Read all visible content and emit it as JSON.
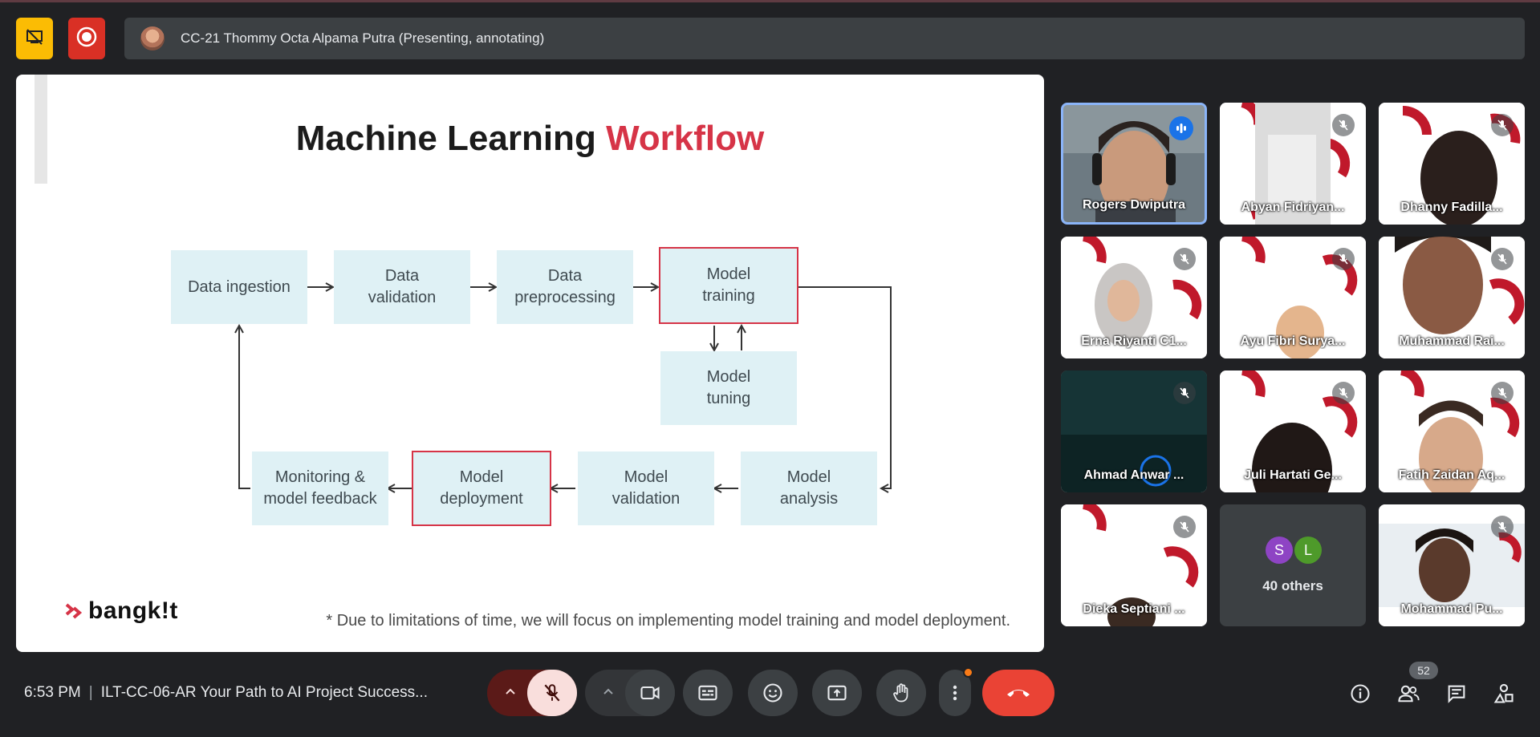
{
  "presenter_bar": {
    "text": "CC-21 Thommy Octa Alpama Putra (Presenting, annotating)"
  },
  "slide": {
    "title_main": "Machine Learning",
    "title_highlight": "Workflow",
    "highlight_color": "#d63447",
    "boxes": {
      "data_ingestion": "Data ingestion",
      "data_validation": "Data\nvalidation",
      "data_preprocessing": "Data\npreprocessing",
      "model_training": "Model\ntraining",
      "model_tuning": "Model\ntuning",
      "model_analysis": "Model\nanalysis",
      "model_validation": "Model\nvalidation",
      "model_deployment": "Model\ndeployment",
      "monitoring": "Monitoring &\nmodel feedback"
    },
    "logo_text": "bangk!t",
    "footnote": "* Due to limitations of time, we will focus on implementing model training and model deployment."
  },
  "participants": [
    {
      "name": "Rogers Dwiputra",
      "state": "speaking"
    },
    {
      "name": "Abyan Fidriyan...",
      "state": "muted"
    },
    {
      "name": "Dhanny Fadilla...",
      "state": "muted"
    },
    {
      "name": "Erna Riyanti C1...",
      "state": "muted"
    },
    {
      "name": "Ayu Fibri Surya...",
      "state": "muted"
    },
    {
      "name": "Muhammad Rai...",
      "state": "muted"
    },
    {
      "name": "Ahmad Anwar ...",
      "state": "muted"
    },
    {
      "name": "Juli Hartati Ge...",
      "state": "muted"
    },
    {
      "name": "Fatih Zaidan Aq...",
      "state": "muted"
    },
    {
      "name": "Dieka Septiani ...",
      "state": "muted"
    },
    {
      "name": "Mohammad Pu...",
      "state": "muted"
    }
  ],
  "others_tile": {
    "avatars": [
      {
        "letter": "S",
        "color": "#8e44c4"
      },
      {
        "letter": "L",
        "color": "#4e9a2a"
      }
    ],
    "label": "40 others"
  },
  "bottom_bar": {
    "time": "6:53 PM",
    "separator": "|",
    "meeting_title": "ILT-CC-06-AR Your Path to AI Project Success...",
    "people_count": "52"
  },
  "icons": {
    "top_left_1": "present-off-icon",
    "top_left_2": "recording-icon",
    "mic": "mic-off-icon",
    "cam": "camera-icon",
    "captions": "captions-icon",
    "emoji": "emoji-icon",
    "present": "present-screen-icon",
    "hand": "raise-hand-icon",
    "more": "more-vert-icon",
    "end": "end-call-icon",
    "info": "info-icon",
    "people": "people-icon",
    "chat": "chat-icon",
    "activities": "activities-icon"
  },
  "colors": {
    "background": "#202124",
    "surface": "#3c4043",
    "end_call": "#ea4335",
    "mic_muted_bg": "#f9dedc",
    "active_speaker_border": "#8ab4f8",
    "present_off_yellow": "#fbbc04",
    "record_red": "#d93025"
  }
}
